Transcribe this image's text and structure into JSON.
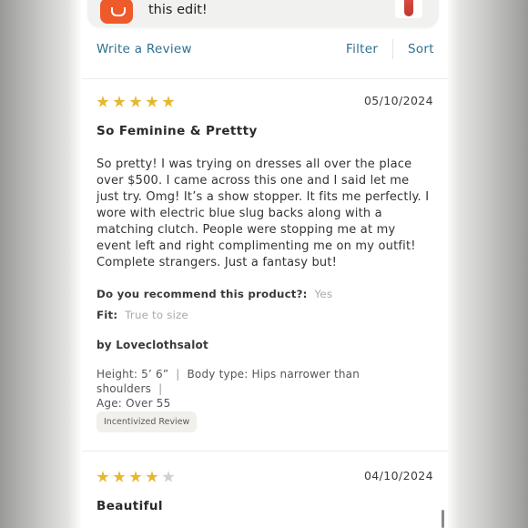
{
  "banner": {
    "text": "this edit!"
  },
  "actions": {
    "write_review": "Write a Review",
    "filter": "Filter",
    "sort": "Sort"
  },
  "reviews": [
    {
      "rating": 5,
      "rating_max": 5,
      "date": "05/10/2024",
      "title": "So Feminine & Prettty",
      "body": "So pretty!  I was trying on dresses all over the place over $500.  I came across this one and I said let me just try.  Omg!  It’s a show stopper.  It fits me perfectly.  I wore with electric blue slug backs along with a matching clutch.  People were stopping me at my event left and right complimenting me on my outfit!  Complete strangers.  Just a fantasy but!",
      "recommend_label": "Do you recommend this product?:",
      "recommend_value": "Yes",
      "fit_label": "Fit:",
      "fit_value": "True to size",
      "author": "by Loveclothsalot",
      "height": "Height: 5’ 6”",
      "body_type": "Body type: Hips narrower than shoulders",
      "age": "Age: Over 55",
      "badge": "Incentivized Review"
    },
    {
      "rating": 4,
      "rating_max": 5,
      "date": "04/10/2024",
      "title": "Beautiful"
    }
  ],
  "colors": {
    "star": "#e8b730",
    "star_empty": "#cfcfcf",
    "link": "#2f6f8f",
    "muted": "#a9a9a9"
  }
}
